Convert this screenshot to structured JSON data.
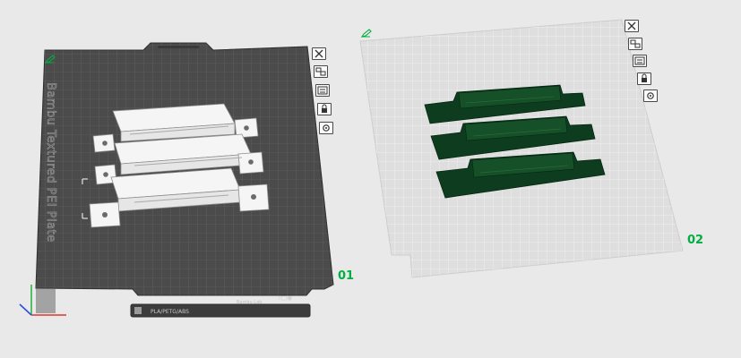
{
  "scene": {
    "background": "#e9e9e9",
    "accent": "#00ae42",
    "model_color": "#0d3d1e",
    "plate1_color": "#4b4b4b",
    "plate2_color": "#dcdcdc"
  },
  "plates": [
    {
      "id": "01",
      "label": "01",
      "selected": true,
      "texture_label": "Bambu Textured PEI Plate",
      "filament_label": "PLA/PETG/ABS",
      "logo_text": "Bambu Lab",
      "parts": 3,
      "toolbar": [
        {
          "name": "remove-plate-icon",
          "action": "Delete plate"
        },
        {
          "name": "arrange-icon",
          "action": "Arrange"
        },
        {
          "name": "plate-settings-icon",
          "action": "Plate settings"
        },
        {
          "name": "lock-icon",
          "action": "Lock plate"
        },
        {
          "name": "gear-icon",
          "action": "Plate settings"
        }
      ]
    },
    {
      "id": "02",
      "label": "02",
      "selected": false,
      "parts": 3,
      "toolbar": [
        {
          "name": "remove-plate-icon",
          "action": "Delete plate"
        },
        {
          "name": "arrange-icon",
          "action": "Arrange"
        },
        {
          "name": "plate-settings-icon",
          "action": "Plate settings"
        },
        {
          "name": "lock-icon",
          "action": "Lock plate"
        },
        {
          "name": "gear-icon",
          "action": "Plate settings"
        }
      ]
    }
  ]
}
